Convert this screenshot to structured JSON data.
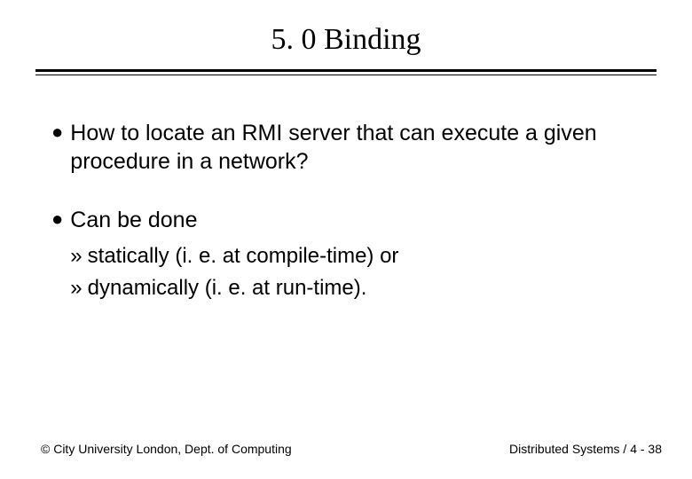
{
  "title": "5. 0 Binding",
  "bullets": [
    {
      "text": "How to locate an RMI server that can execute a given procedure in a network?",
      "subs": []
    },
    {
      "text": "Can be done",
      "subs": [
        "statically (i. e. at compile-time) or",
        "dynamically (i. e. at run-time)."
      ]
    }
  ],
  "footer": {
    "left": "© City University London, Dept. of Computing",
    "right": "Distributed Systems / 4 - 38"
  }
}
